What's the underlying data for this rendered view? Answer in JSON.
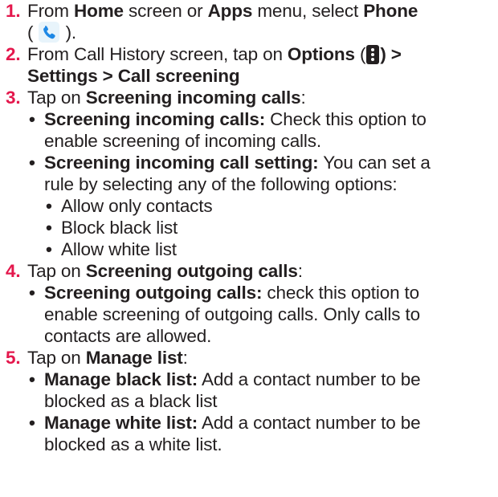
{
  "steps": [
    {
      "number": "1.",
      "line1": [
        "From ",
        "Home",
        " screen or ",
        "Apps",
        " menu, select ",
        "Phone"
      ],
      "line2": [
        "(",
        ")."
      ]
    },
    {
      "number": "2.",
      "line1": [
        "From Call History screen, tap on ",
        "Options",
        " (",
        ") >"
      ],
      "line2": [
        "Settings > Call screening"
      ]
    },
    {
      "number": "3.",
      "line1": [
        "Tap on ",
        "Screening incoming calls",
        ":"
      ],
      "bullets": [
        {
          "title": "Screening incoming calls:",
          "text1": " Check this option to",
          "text2": "enable screening of incoming calls."
        },
        {
          "title": "Screening incoming call setting:",
          "text1": " You can set a",
          "text2": "rule by selecting any of the following options:",
          "options": [
            "Allow only contacts",
            "Block black list",
            "Allow white list"
          ]
        }
      ]
    },
    {
      "number": "4.",
      "line1": [
        "Tap on ",
        "Screening outgoing calls",
        ":"
      ],
      "bullets": [
        {
          "title": "Screening outgoing calls:",
          "text1": " check this option to",
          "text2": "enable screening of outgoing calls. Only calls to",
          "text3": "contacts are allowed."
        }
      ]
    },
    {
      "number": "5.",
      "line1": [
        "Tap on ",
        "Manage list",
        ":"
      ],
      "bullets": [
        {
          "title": "Manage black list:",
          "text1": " Add a contact number to be",
          "text2": "blocked as a black list"
        },
        {
          "title": "Manage white list:",
          "text1": " Add a contact number to be",
          "text2": "blocked as a white list."
        }
      ]
    }
  ],
  "icons": {
    "phone": "phone-icon",
    "options": "vertical-dots-icon"
  },
  "colors": {
    "step_number": "#e4174c",
    "text": "#231f20",
    "phone_icon": "#1e88e5"
  }
}
